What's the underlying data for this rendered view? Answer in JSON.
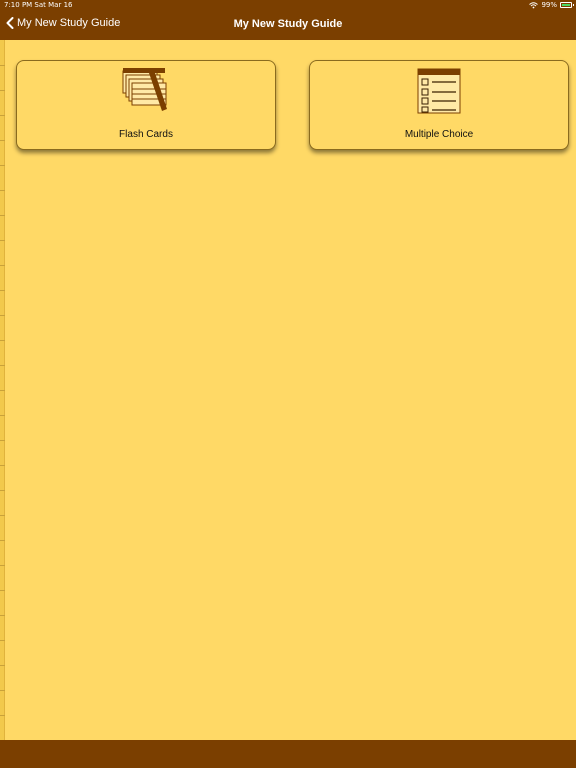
{
  "status_bar": {
    "time": "7:10 PM   Sat Mar 16",
    "battery": "99%"
  },
  "nav": {
    "back_label": "My New Study Guide",
    "title": "My New Study Guide"
  },
  "cards": [
    {
      "label": "Flash Cards",
      "icon": "flash-cards-icon"
    },
    {
      "label": "Multiple Choice",
      "icon": "checklist-icon"
    }
  ],
  "colors": {
    "bar": "#7B3F00",
    "background": "#FFD966"
  }
}
